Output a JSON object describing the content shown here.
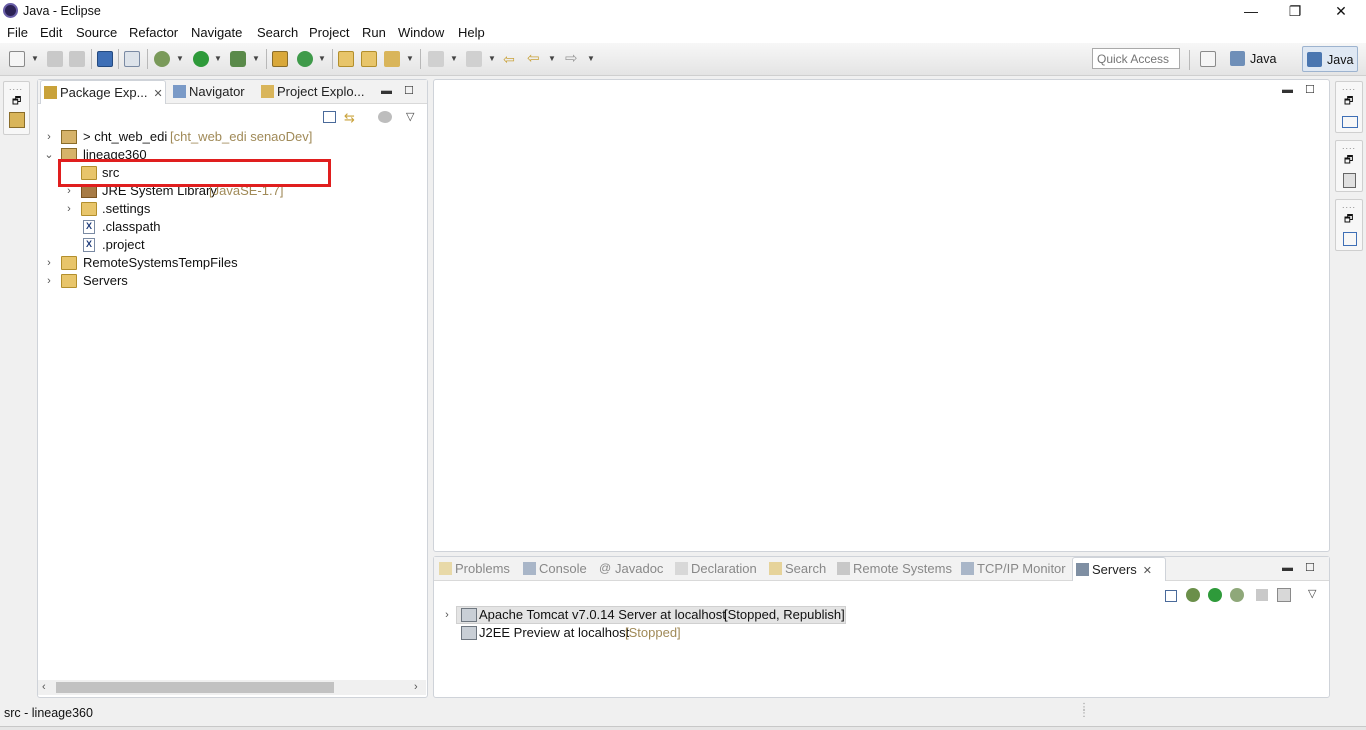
{
  "window": {
    "title": "Java - Eclipse",
    "controls": {
      "minimize": "—",
      "restore": "❐",
      "close": "✕"
    }
  },
  "menu": [
    "File",
    "Edit",
    "Source",
    "Refactor",
    "Navigate",
    "Search",
    "Project",
    "Run",
    "Window",
    "Help"
  ],
  "toolbar": {
    "quick_access_placeholder": "Quick Access",
    "perspectives": [
      {
        "label": "Java EE",
        "active": false,
        "icon": "javaee-perspective-icon"
      },
      {
        "label": "Java",
        "active": true,
        "icon": "java-perspective-icon"
      }
    ]
  },
  "left_view": {
    "tabs": [
      {
        "label": "Package Exp...",
        "active": true,
        "icon": "package-explorer-icon",
        "closable": true
      },
      {
        "label": "Navigator",
        "active": false,
        "icon": "navigator-icon"
      },
      {
        "label": "Project Explo...",
        "active": false,
        "icon": "project-explorer-icon"
      }
    ],
    "tree": [
      {
        "name": "> cht_web_edi",
        "decoration": "[cht_web_edi senaoDev]",
        "expanded": false,
        "icon": "project-icon"
      },
      {
        "name": "lineage360",
        "expanded": true,
        "icon": "project-icon"
      },
      {
        "name": "src",
        "icon": "source-folder-icon",
        "highlighted": true
      },
      {
        "name": "JRE System Library",
        "decoration": "[JavaSE-1.7]",
        "expanded": false,
        "icon": "library-icon"
      },
      {
        "name": ".settings",
        "expanded": false,
        "icon": "folder-icon"
      },
      {
        "name": ".classpath",
        "icon": "xml-file-icon"
      },
      {
        "name": ".project",
        "icon": "xml-file-icon"
      },
      {
        "name": "RemoteSystemsTempFiles",
        "expanded": false,
        "icon": "project-icon"
      },
      {
        "name": "Servers",
        "expanded": false,
        "icon": "servers-project-icon"
      }
    ]
  },
  "bottom_view": {
    "tabs": [
      {
        "label": "Problems",
        "active": false,
        "icon": "problems-icon"
      },
      {
        "label": "Console",
        "active": false,
        "icon": "console-icon"
      },
      {
        "label": "Javadoc",
        "active": false,
        "icon": "javadoc-icon"
      },
      {
        "label": "Declaration",
        "active": false,
        "icon": "declaration-icon"
      },
      {
        "label": "Search",
        "active": false,
        "icon": "search-icon"
      },
      {
        "label": "Remote Systems",
        "active": false,
        "icon": "remote-systems-icon"
      },
      {
        "label": "TCP/IP Monitor",
        "active": false,
        "icon": "tcpip-monitor-icon"
      },
      {
        "label": "Servers",
        "active": true,
        "icon": "servers-icon",
        "closable": true
      }
    ],
    "servers": [
      {
        "name": "Apache Tomcat v7.0.14 Server at localhost",
        "state": "[Stopped, Republish]",
        "selected": true,
        "expandable": true
      },
      {
        "name": "J2EE Preview at localhost",
        "state": "[Stopped]",
        "selected": false,
        "expandable": false
      }
    ]
  },
  "status_bar": {
    "text": "src - lineage360"
  },
  "colors": {
    "highlight_box": "#e01e1e",
    "decoration": "#a08a58",
    "toolbar_bg": "#e9e9e9"
  }
}
